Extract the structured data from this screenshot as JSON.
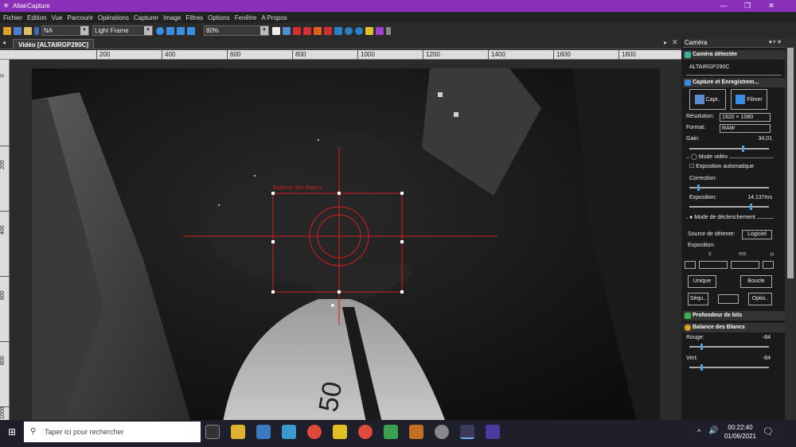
{
  "window": {
    "title": "AltairCapture",
    "minimize": "—",
    "maximize": "❐",
    "close": "✕"
  },
  "menu": [
    "Fichier",
    "Edition",
    "Vue",
    "Parcourir",
    "Opérations",
    "Capturer",
    "Image",
    "Filtres",
    "Options",
    "Fenêtre",
    "A Propos"
  ],
  "toolbar": {
    "filter_select": "NA",
    "frame_select": "Light Frame",
    "zoom_select": "80%"
  },
  "document": {
    "tab_label": "Vidéo [ALTAIRGP290C]",
    "ruler_h": [
      "200",
      "400",
      "600",
      "800",
      "1000",
      "1200",
      "1400",
      "1600",
      "1800"
    ],
    "ruler_v": [
      "0",
      "200",
      "400",
      "600",
      "800",
      "1000"
    ],
    "overlay_label": "Balance des Blancs",
    "frame_text": "50"
  },
  "panel": {
    "title": "Caméra",
    "detected_header": "Caméra détectée",
    "camera_name": "ALTAIRGP290C",
    "capture_header": "Capture et Enregistrem...",
    "capture_btn": "Capt..",
    "record_btn": "Filmer",
    "resolution_label": "Résolution:",
    "resolution_value": "1920 × 1080",
    "format_label": "Format:",
    "format_value": "RAW",
    "gain_label": "Gain:",
    "gain_value": "34,01",
    "video_mode": "Mode vidéo",
    "auto_exposure": "Exposition automatique",
    "correction_label": "Correction:",
    "exposure_label": "Exposition:",
    "exposure_value": "14.137ms",
    "trigger_mode": "Mode de déclenchement",
    "trigger_source_label": "Source de détente:",
    "trigger_source_value": "Logiciel",
    "exposure_label2": "Exposition:",
    "unit_s": "s",
    "unit_ms": "ms",
    "unit_us": "µ",
    "single_btn": "Unique",
    "loop_btn": "Boucle",
    "seq_btn": "Séqu..",
    "opts_btn": "Optio..",
    "bit_depth_header": "Profondeur de bits",
    "wb_header": "Balance des Blancs",
    "red_label": "Rouge:",
    "red_value": "-84",
    "green_label": "Vert:",
    "green_value": "-84"
  },
  "taskbar": {
    "search_placeholder": "Taper ici pour rechercher",
    "time": "00:22:40",
    "date": "01/06/2021",
    "volume": "🔊",
    "notifications": "🗨",
    "tray_chevron": "^"
  },
  "colors": {
    "titlebar": "#8a2fb8",
    "reticle": "#d21f1f",
    "accent": "#4aa0e0"
  }
}
